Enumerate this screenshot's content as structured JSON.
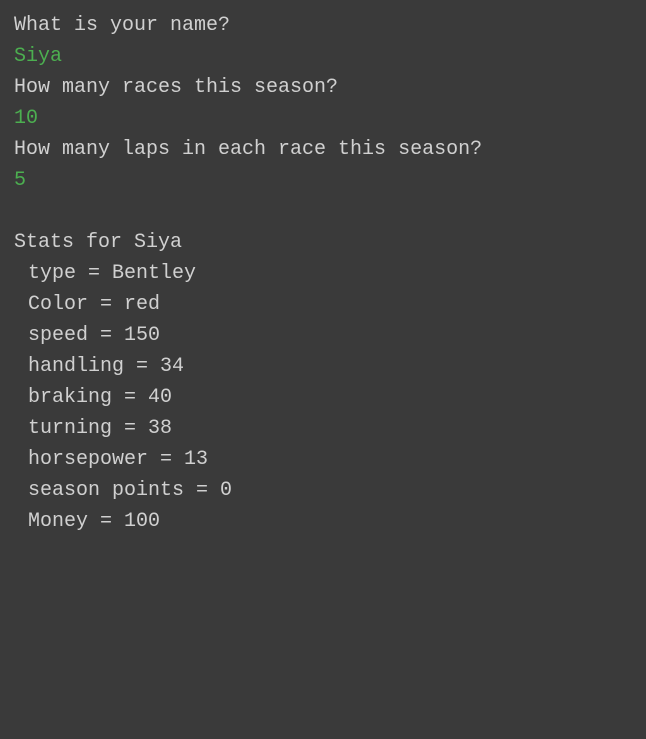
{
  "prompts": {
    "q1": "What is your name?",
    "a1": "Siya",
    "q2": "How many races this season?",
    "a2": "10",
    "q3": "How many laps in each race this season?",
    "a3": "5"
  },
  "stats": {
    "header": "Stats for Siya",
    "rows": [
      "type = Bentley",
      "Color = red",
      "speed = 150",
      "handling = 34",
      "braking = 40",
      "turning = 38",
      "horsepower = 13",
      "season points = 0",
      "Money = 100"
    ]
  }
}
